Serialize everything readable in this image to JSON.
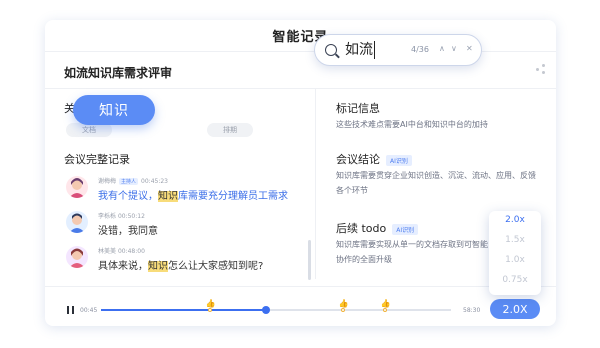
{
  "window": {
    "title": "智能记录"
  },
  "doc": {
    "title": "如流知识库需求评审"
  },
  "search": {
    "query": "如流",
    "count": "4/36",
    "prev": "∧",
    "next": "∨",
    "close": "✕"
  },
  "keywords": {
    "label": "关键词",
    "chips": [
      "文档",
      "知识",
      "排期"
    ]
  },
  "transcript": {
    "label": "会议完整记录",
    "entries": [
      {
        "name": "谢梅梅",
        "host_tag": "主持人",
        "time": "00:45:23",
        "pre": "我有个提议，",
        "highlight": "知识",
        "post": "库需要充分理解员工需求"
      },
      {
        "name": "李栎栎",
        "time": "00:50:12",
        "text": "没错，我同意"
      },
      {
        "name": "林美美",
        "time": "00:48:00",
        "pre": "具体来说，",
        "highlight": "知识",
        "post": "怎么让大家感知到呢?"
      }
    ]
  },
  "notes": {
    "marks": {
      "title": "标记信息",
      "body": "这些技术难点需要AI中台和知识中台的加持"
    },
    "conclusion": {
      "title": "会议结论",
      "tag": "AI识别",
      "body": "知识库需要贯穿企业知识创造、沉淀、流动、应用、反馈各个环节"
    },
    "todo": {
      "title": "后续 todo",
      "tag": "AI识别",
      "body": "知识库需要实现从单一的文档存取到可智能协作的全面升级"
    }
  },
  "player": {
    "current": "00:45",
    "total": "58:30",
    "progress": 0.47,
    "marker_positions": [
      0.31,
      0.69,
      0.81
    ],
    "speed": "2.0X",
    "speed_options": [
      "2.0x",
      "1.5x",
      "1.0x",
      "0.75x"
    ],
    "selected_speed": "2.0x"
  },
  "colors": {
    "accent": "#5b8cf5",
    "highlight": "#f8dc7a",
    "marker": "#f0b33a"
  }
}
